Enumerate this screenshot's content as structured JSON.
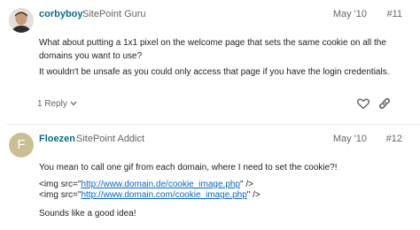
{
  "posts": [
    {
      "username": "corbyboy",
      "user_title": "SitePoint Guru",
      "date": "May '10",
      "post_number": "#11",
      "paragraphs": [
        "What about putting a 1x1 pixel on the welcome page that sets the same cookie on all the domains you want to use?",
        "It wouldn't be unsafe as you could only access that page if you have the login credentials."
      ],
      "replies_label": "1 Reply",
      "icons": [
        "chevron-down-icon",
        "heart-icon",
        "link-icon"
      ]
    },
    {
      "username": "Floezen",
      "user_title": "SitePoint Addict",
      "avatar_letter": "F",
      "date": "May '10",
      "post_number": "#12",
      "paragraph_1": "You mean to call one gif from each domain, where I need to set the cookie?!",
      "code_lines": [
        {
          "prefix": "<img src=\"",
          "url": "http://www.domain.de/cookie_image.php",
          "suffix": "\" />"
        },
        {
          "prefix": "<img src=\"",
          "url": "http://www.domain.com/cookie_image.php",
          "suffix": "\" />"
        }
      ],
      "paragraph_2": "Sounds like a good idea!"
    }
  ],
  "colors": {
    "username": "#0b6b8a",
    "meta": "#646464",
    "link": "#0a66c2",
    "avatar_letter_bg": "#c9bf93"
  }
}
